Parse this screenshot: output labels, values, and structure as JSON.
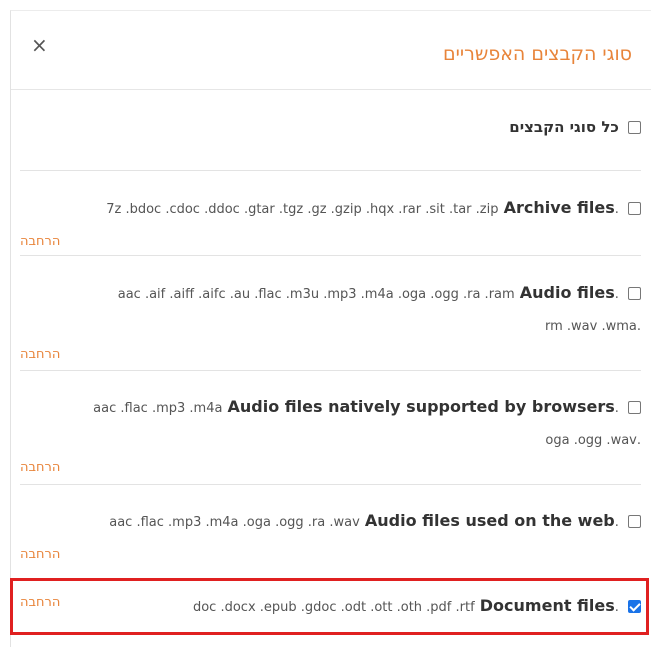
{
  "dialog": {
    "title": "סוגי הקבצים האפשריים",
    "close_glyph": "×",
    "all_types_label": "כל סוגי הקבצים",
    "expand_label": "הרחבה"
  },
  "file_types": [
    {
      "name": "Archive files",
      "extensions": ".7z .bdoc .cdoc .ddoc .gtar .tgz .gz .gzip .hqx .rar .sit .tar .zip",
      "extensions_line2": "",
      "checked": false
    },
    {
      "name": "Audio files",
      "extensions": ".aac .aif .aiff .aifc .au .flac .m3u .mp3 .m4a .oga .ogg .ra .ram",
      "extensions_line2": ".rm .wav .wma",
      "checked": false
    },
    {
      "name": "Audio files natively supported by browsers",
      "extensions": ".aac .flac .mp3 .m4a",
      "extensions_line2": ".oga .ogg .wav",
      "checked": false
    },
    {
      "name": "Audio files used on the web",
      "extensions": ".aac .flac .mp3 .m4a .oga .ogg .ra .wav",
      "extensions_line2": "",
      "checked": false
    },
    {
      "name": "Document files",
      "extensions": ".doc .docx .epub .gdoc .odt .ott .oth .pdf .rtf",
      "extensions_line2": "",
      "checked": true
    }
  ],
  "colors": {
    "accent": "#e8843a",
    "highlight": "#e02020",
    "checkbox_checked": "#1a73e8"
  }
}
